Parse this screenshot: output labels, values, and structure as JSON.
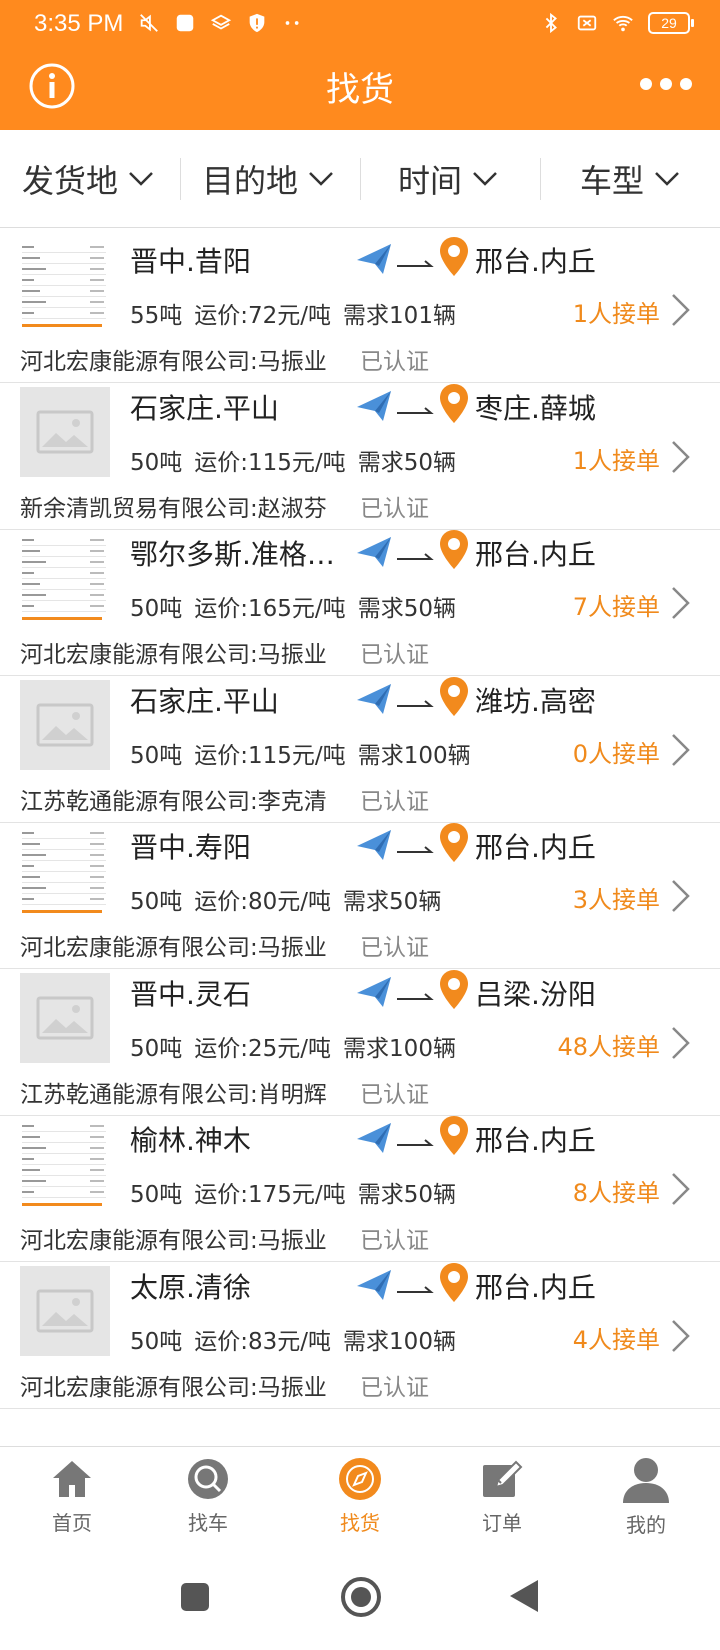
{
  "status_bar": {
    "time": "3:35 PM",
    "battery": "29"
  },
  "header": {
    "title": "找货"
  },
  "filters": [
    {
      "label": "发货地"
    },
    {
      "label": "目的地"
    },
    {
      "label": "时间"
    },
    {
      "label": "车型"
    }
  ],
  "items": [
    {
      "origin": "晋中.昔阳",
      "dest": "邢台.内丘",
      "weight": "55吨",
      "price": "运价:72元/吨",
      "demand": "需求101辆",
      "takers": "1人接单",
      "company": "河北宏康能源有限公司:马振业",
      "cert": "已认证",
      "thumb": "screenshot"
    },
    {
      "origin": "石家庄.平山",
      "dest": "枣庄.薛城",
      "weight": "50吨",
      "price": "运价:115元/吨",
      "demand": "需求50辆",
      "takers": "1人接单",
      "company": "新余清凯贸易有限公司:赵淑芬",
      "cert": "已认证",
      "thumb": "placeholder"
    },
    {
      "origin": "鄂尔多斯.准格尔...",
      "dest": "邢台.内丘",
      "weight": "50吨",
      "price": "运价:165元/吨",
      "demand": "需求50辆",
      "takers": "7人接单",
      "company": "河北宏康能源有限公司:马振业",
      "cert": "已认证",
      "thumb": "screenshot"
    },
    {
      "origin": "石家庄.平山",
      "dest": "潍坊.高密",
      "weight": "50吨",
      "price": "运价:115元/吨",
      "demand": "需求100辆",
      "takers": "0人接单",
      "company": "江苏乾通能源有限公司:李克清",
      "cert": "已认证",
      "thumb": "placeholder"
    },
    {
      "origin": "晋中.寿阳",
      "dest": "邢台.内丘",
      "weight": "50吨",
      "price": "运价:80元/吨",
      "demand": "需求50辆",
      "takers": "3人接单",
      "company": "河北宏康能源有限公司:马振业",
      "cert": "已认证",
      "thumb": "screenshot"
    },
    {
      "origin": "晋中.灵石",
      "dest": "吕梁.汾阳",
      "weight": "50吨",
      "price": "运价:25元/吨",
      "demand": "需求100辆",
      "takers": "48人接单",
      "company": "江苏乾通能源有限公司:肖明辉",
      "cert": "已认证",
      "thumb": "placeholder"
    },
    {
      "origin": "榆林.神木",
      "dest": "邢台.内丘",
      "weight": "50吨",
      "price": "运价:175元/吨",
      "demand": "需求50辆",
      "takers": "8人接单",
      "company": "河北宏康能源有限公司:马振业",
      "cert": "已认证",
      "thumb": "screenshot"
    },
    {
      "origin": "太原.清徐",
      "dest": "邢台.内丘",
      "weight": "50吨",
      "price": "运价:83元/吨",
      "demand": "需求100辆",
      "takers": "4人接单",
      "company": "河北宏康能源有限公司:马振业",
      "cert": "已认证",
      "thumb": "placeholder"
    }
  ],
  "tabs": [
    {
      "label": "首页",
      "icon": "home-icon"
    },
    {
      "label": "找车",
      "icon": "search-car-icon"
    },
    {
      "label": "找货",
      "icon": "compass-icon",
      "active": true
    },
    {
      "label": "订单",
      "icon": "edit-icon"
    },
    {
      "label": "我的",
      "icon": "profile-icon"
    }
  ],
  "colors": {
    "accent": "#ff8a1e",
    "takers": "#f08a1c",
    "send_icon": "#4a90d9"
  }
}
